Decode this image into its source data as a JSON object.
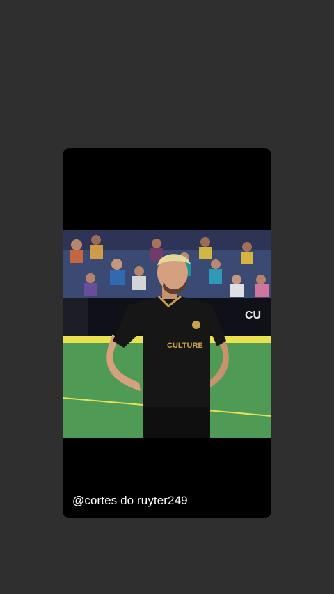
{
  "story": {
    "caption": "@cortes do ruyter249",
    "photo_alt": "soccer player in black jersey on indoor field"
  },
  "photo": {
    "jersey_brand": "CULTURE",
    "banner_text": "CU"
  },
  "colors": {
    "background": "#2f2f2f",
    "card": "#000000",
    "turf": "#4f9a55",
    "jersey": "#161616",
    "accent_gold": "#c9a24a"
  }
}
